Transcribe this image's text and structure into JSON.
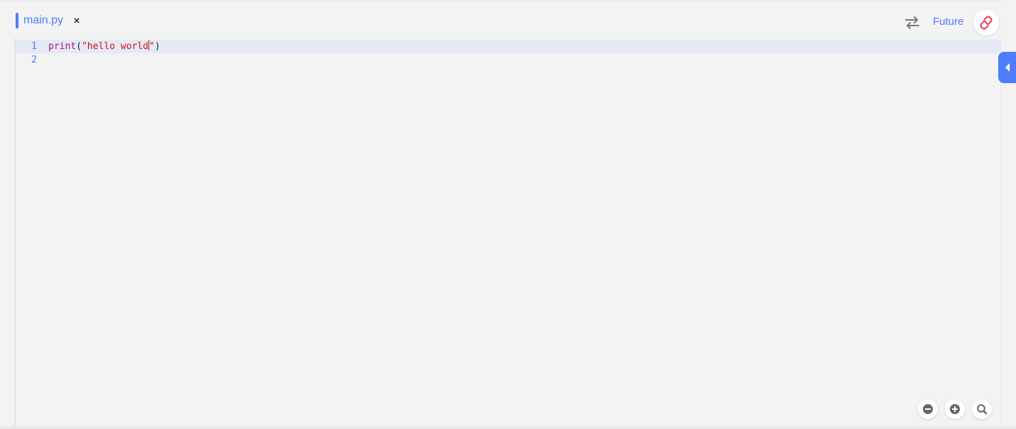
{
  "tabs": [
    {
      "label": "main.py",
      "close_label": "×",
      "active": true
    }
  ],
  "header": {
    "swap_icon": "swap-arrows-icon",
    "future_label": "Future",
    "unlink_icon": "unlink-icon"
  },
  "editor": {
    "lines": [
      {
        "number": "1",
        "fn": "print",
        "open": "(",
        "str": "\"hello world",
        "str_end": "\"",
        "close": ")"
      },
      {
        "number": "2"
      }
    ]
  },
  "side_toggle_icon": "chevron-left-icon",
  "zoom": {
    "zoom_out_icon": "zoom-out-icon",
    "zoom_in_icon": "zoom-in-icon",
    "search_icon": "search-icon"
  },
  "colors": {
    "accent": "#4d7cfe",
    "keyword": "#a0147a",
    "string": "#d1101a",
    "unlink": "#e8455a"
  }
}
